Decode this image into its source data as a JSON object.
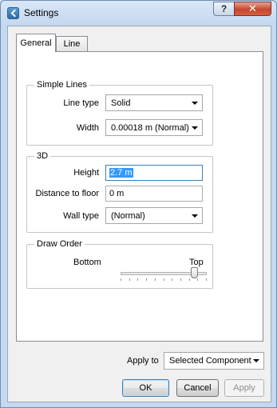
{
  "window": {
    "title": "Settings",
    "help_label": "?",
    "close_label": "✕",
    "app_icon": "back-arrow-icon"
  },
  "tabs": [
    {
      "label": "General",
      "active": true
    },
    {
      "label": "Line",
      "active": false
    }
  ],
  "simple_lines": {
    "legend": "Simple Lines",
    "line_type_label": "Line type",
    "line_type_value": "Solid",
    "width_label": "Width",
    "width_value": "0.00018 m (Normal)"
  },
  "three_d": {
    "legend": "3D",
    "height_label": "Height",
    "height_value": "2.7 m",
    "distance_label": "Distance to floor",
    "distance_value": "0 m",
    "wall_type_label": "Wall type",
    "wall_type_value": "(Normal)"
  },
  "draw_order": {
    "legend": "Draw Order",
    "bottom_label": "Bottom",
    "top_label": "Top",
    "slider_level": 0.86
  },
  "apply_to": {
    "label": "Apply to",
    "value": "Selected Component"
  },
  "buttons": {
    "ok": "OK",
    "cancel": "Cancel",
    "apply": "Apply"
  },
  "colors": {
    "selection": "#3399ff",
    "close_button": "#c7472f",
    "focus_border": "#3c7fb1"
  }
}
